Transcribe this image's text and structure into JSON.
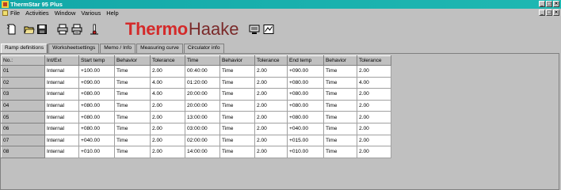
{
  "window": {
    "title": "ThermStar 95 Plus",
    "min_glyph": "_",
    "max_glyph": "□",
    "close_glyph": "×"
  },
  "menu": {
    "items": [
      "File",
      "Activities",
      "Window",
      "Various",
      "Help"
    ]
  },
  "toolbar": {
    "icons": [
      "new-icon",
      "open-icon",
      "save-icon",
      "print-icon",
      "print-preview-icon",
      "thermometer-icon",
      "monitor-icon",
      "chart-icon"
    ],
    "logo_thermo": "Thermo",
    "logo_haake": "Haake"
  },
  "tabs": [
    "Ramp definitions",
    "Worksheetsettings",
    "Memo / Info",
    "Measuring curve",
    "Circulator info"
  ],
  "active_tab": 0,
  "table": {
    "columns": [
      "No.:",
      "Int/Ext",
      "Start temp",
      "Behavior",
      "Tolerance",
      "Time",
      "Behavior",
      "Tolerance",
      "End temp",
      "Behavior",
      "Tolerance"
    ],
    "rows": [
      [
        "01",
        "Internal",
        "+100.00",
        "Time",
        "2.00",
        "00:40:00",
        "Time",
        "2.00",
        "+090.00",
        "Time",
        "2.00"
      ],
      [
        "02",
        "Internal",
        "+090.00",
        "Time",
        "4.00",
        "01:20:00",
        "Time",
        "2.00",
        "+080.00",
        "Time",
        "4.00"
      ],
      [
        "03",
        "Internal",
        "+080.00",
        "Time",
        "4.00",
        "20:00:00",
        "Time",
        "2.00",
        "+080.00",
        "Time",
        "2.00"
      ],
      [
        "04",
        "Internal",
        "+080.00",
        "Time",
        "2.00",
        "20:00:00",
        "Time",
        "2.00",
        "+080.00",
        "Time",
        "2.00"
      ],
      [
        "05",
        "Internal",
        "+080.00",
        "Time",
        "2.00",
        "13:00:00",
        "Time",
        "2.00",
        "+080.00",
        "Time",
        "2.00"
      ],
      [
        "06",
        "Internal",
        "+080.00",
        "Time",
        "2.00",
        "03:00:00",
        "Time",
        "2.00",
        "+040.00",
        "Time",
        "2.00"
      ],
      [
        "07",
        "Internal",
        "+040.00",
        "Time",
        "2.00",
        "02:00:00",
        "Time",
        "2.00",
        "+015.00",
        "Time",
        "2.00"
      ],
      [
        "08",
        "Internal",
        "+010.00",
        "Time",
        "2.00",
        "14:00:00",
        "Time",
        "2.00",
        "+010.00",
        "Time",
        "2.00"
      ]
    ]
  }
}
